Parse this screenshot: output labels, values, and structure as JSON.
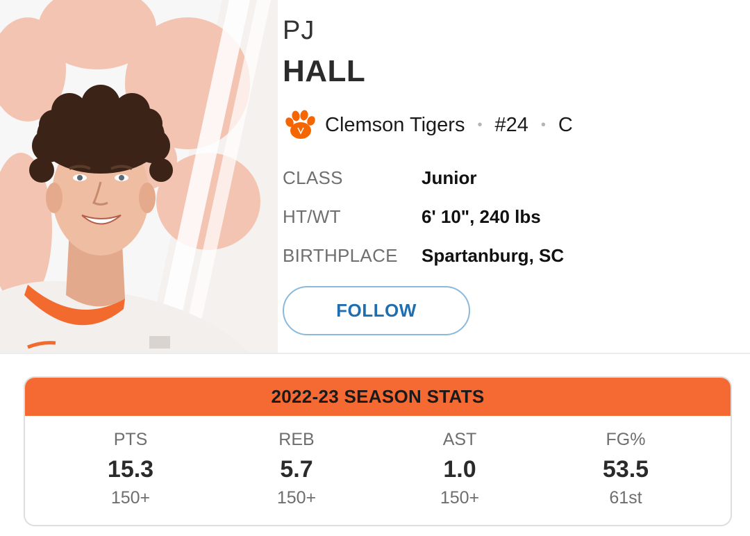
{
  "player": {
    "first_name": "PJ",
    "last_name": "HALL",
    "headshot_icon": "player-headshot",
    "team": {
      "name": "Clemson Tigers",
      "logo_icon": "tiger-paw-icon",
      "logo_color": "#f56600",
      "number": "#24",
      "position": "C",
      "separator": "•"
    },
    "bio": [
      {
        "label": "CLASS",
        "value": "Junior"
      },
      {
        "label": "HT/WT",
        "value": "6' 10\", 240 lbs"
      },
      {
        "label": "BIRTHPLACE",
        "value": "Spartanburg, SC"
      }
    ],
    "follow_label": "FOLLOW"
  },
  "season_stats": {
    "title": "2022-23 SEASON STATS",
    "header_color": "#f56a32",
    "stats": [
      {
        "label": "PTS",
        "value": "15.3",
        "rank": "150+"
      },
      {
        "label": "REB",
        "value": "5.7",
        "rank": "150+"
      },
      {
        "label": "AST",
        "value": "1.0",
        "rank": "150+"
      },
      {
        "label": "FG%",
        "value": "53.5",
        "rank": "61st"
      }
    ]
  }
}
